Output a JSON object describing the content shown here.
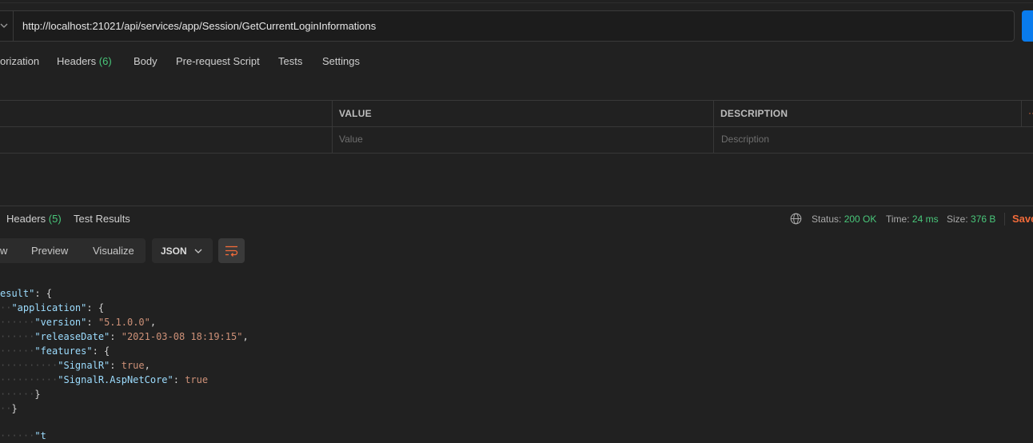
{
  "request": {
    "url": "http://localhost:21021/api/services/app/Session/GetCurrentLoginInformations"
  },
  "request_tabs": {
    "authorization": "orization",
    "headers": "Headers",
    "headers_count": "(6)",
    "body": "Body",
    "pre_request": "Pre-request Script",
    "tests": "Tests",
    "settings": "Settings"
  },
  "params_table": {
    "value_header": "VALUE",
    "description_header": "DESCRIPTION",
    "value_placeholder": "Value",
    "description_placeholder": "Description",
    "bulk_edit_fragment": "··"
  },
  "response_tabs": {
    "headers": "Headers",
    "headers_count": "(5)",
    "test_results": "Test Results"
  },
  "response_meta": {
    "status_label": "Status:",
    "status_value": "200 OK",
    "time_label": "Time:",
    "time_value": "24 ms",
    "size_label": "Size:",
    "size_value": "376 B",
    "save_label": "Save"
  },
  "format_bar": {
    "raw": "w",
    "preview": "Preview",
    "visualize": "Visualize",
    "json": "JSON"
  },
  "code": {
    "l1_key": "esult\"",
    "l1_rest": ": {",
    "l2_key": "\"application\"",
    "l2_rest": ": {",
    "l3_key": "\"version\"",
    "l3_colon": ": ",
    "l3_val": "\"5.1.0.0\"",
    "l3_tail": ",",
    "l4_key": "\"releaseDate\"",
    "l4_colon": ": ",
    "l4_val": "\"2021-03-08 18:19:15\"",
    "l4_tail": ",",
    "l5_key": "\"features\"",
    "l5_rest": ": {",
    "l6_key": "\"SignalR\"",
    "l6_colon": ": ",
    "l6_val": "true",
    "l6_tail": ",",
    "l7_key": "\"SignalR.AspNetCore\"",
    "l7_colon": ": ",
    "l7_val": "true",
    "l8": "}",
    "l9": "}",
    "l10_partial": "\"t"
  },
  "colors": {
    "accent_blue": "#097bed",
    "status_green": "#49c77a",
    "save_orange": "#f26b3a"
  },
  "icons": [
    "chevron-down-icon",
    "globe-icon",
    "wrap-lines-icon"
  ]
}
